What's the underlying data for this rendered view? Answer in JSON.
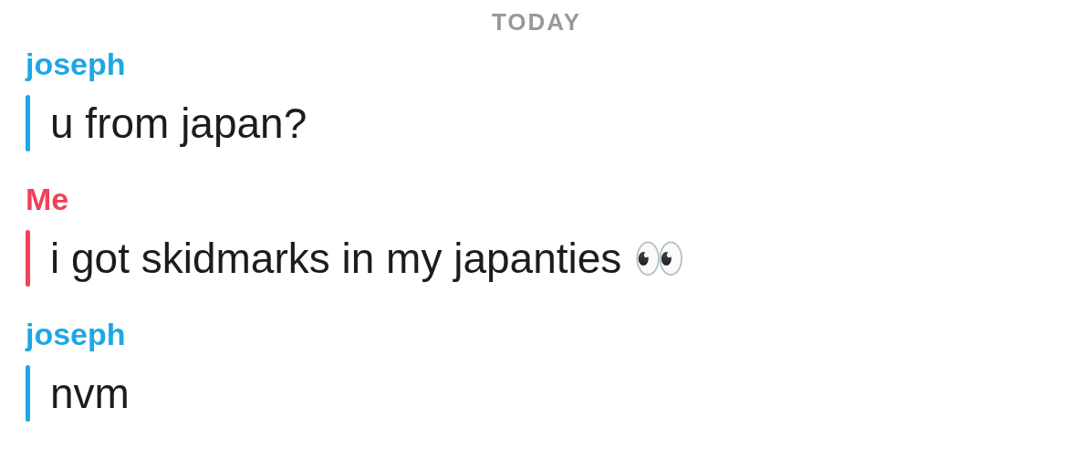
{
  "date_header": "TODAY",
  "messages": [
    {
      "sender": "joseph",
      "kind": "friend",
      "text": "u from japan?"
    },
    {
      "sender": "Me",
      "kind": "me",
      "text": "i got skidmarks in my japanties 👀"
    },
    {
      "sender": "joseph",
      "kind": "friend",
      "text": "nvm"
    }
  ]
}
